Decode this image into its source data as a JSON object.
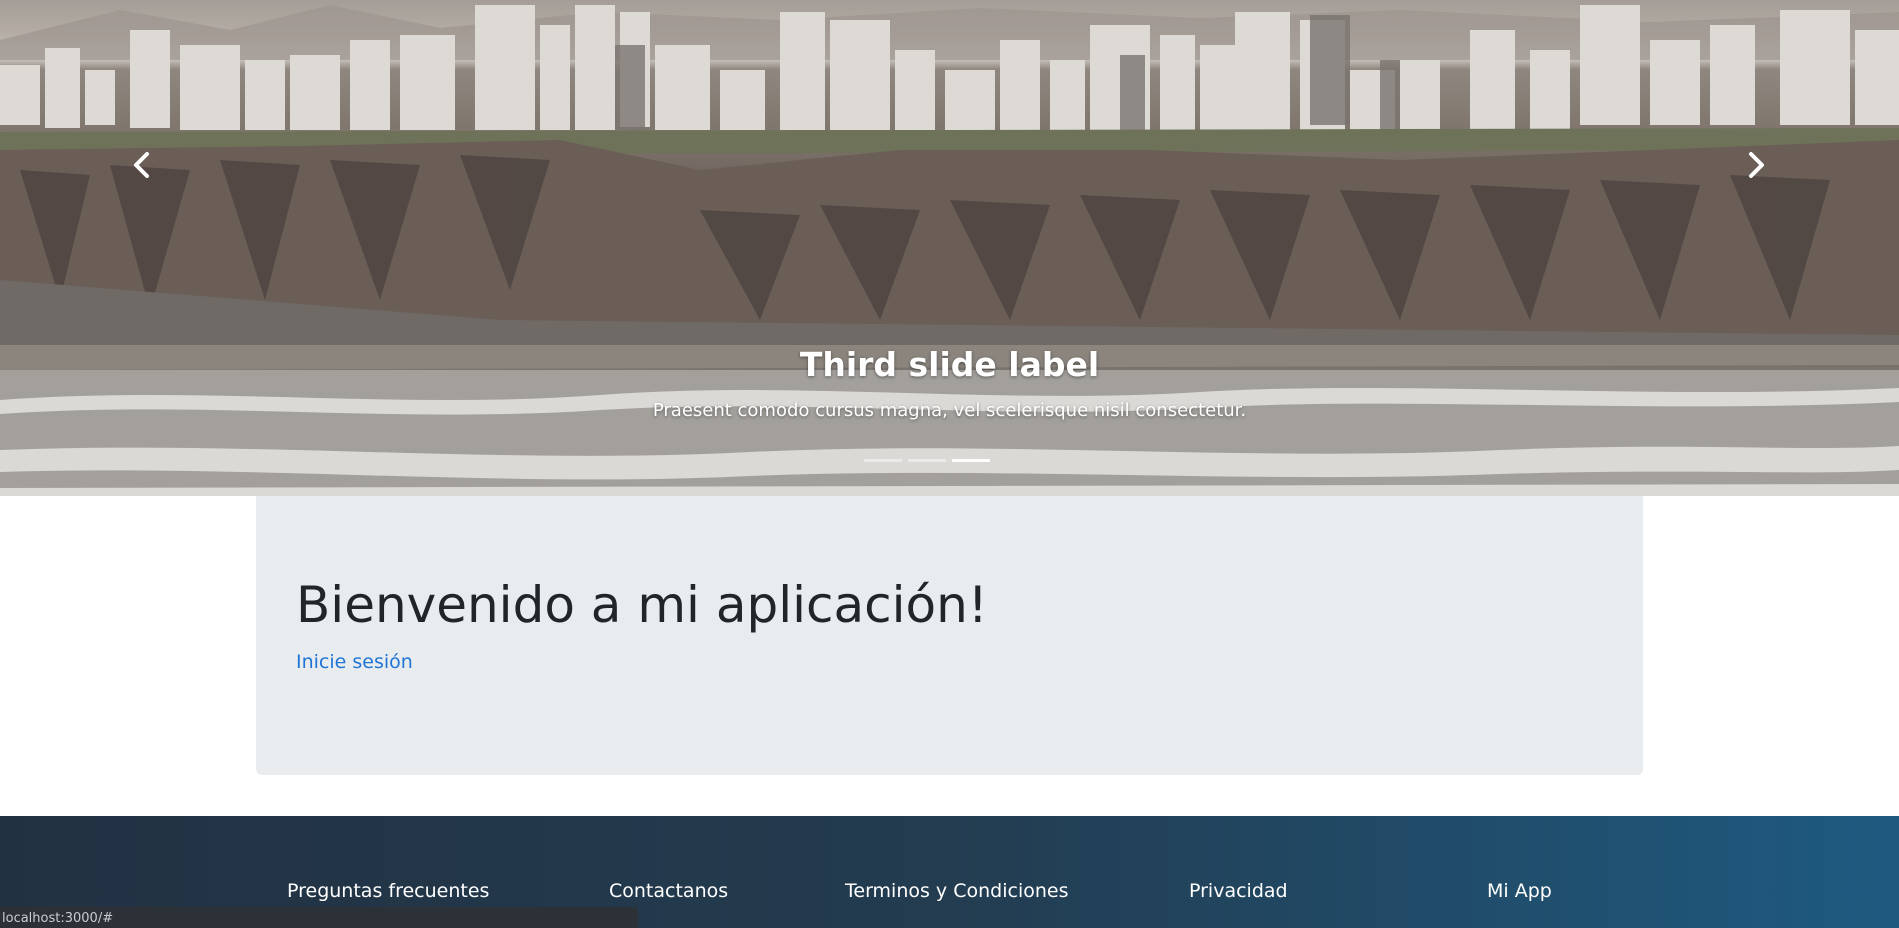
{
  "carousel": {
    "prev_label": "Previous",
    "next_label": "Next",
    "prev_icon": "chevron-left-icon",
    "next_icon": "chevron-right-icon",
    "caption_title": "Third slide label",
    "caption_text": "Praesent comodo cursus magna, vel scelerisque nisil consectetur.",
    "active_index": 2,
    "slide_count": 3
  },
  "jumbotron": {
    "title": "Bienvenido a mi aplicación!",
    "link": "Inicie sesión"
  },
  "footer": {
    "links": [
      "Preguntas frecuentes",
      "Contactanos",
      "Terminos y Condiciones",
      "Privacidad",
      "Mi App"
    ]
  },
  "status_bar": {
    "url": "localhost:3000/#"
  },
  "colors": {
    "link": "#1f75d6",
    "jumbotron_bg": "#e9ecef",
    "footer_start": "#223142",
    "footer_end": "#1e5a80",
    "heading": "#212529"
  }
}
